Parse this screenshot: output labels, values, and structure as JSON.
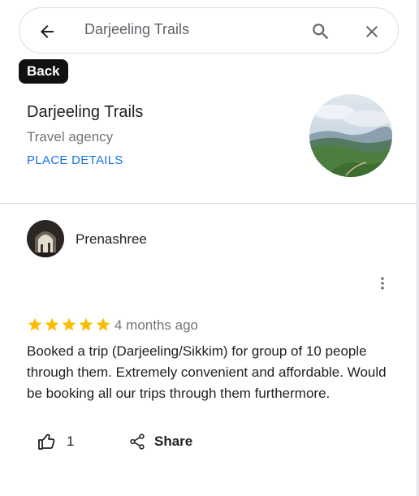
{
  "search": {
    "query": "Darjeeling Trails",
    "back_icon": "arrow-left-icon",
    "search_icon": "search-icon",
    "close_icon": "close-icon"
  },
  "tooltip": {
    "label": "Back"
  },
  "place": {
    "name": "Darjeeling Trails",
    "category": "Travel agency",
    "details_link": "PLACE DETAILS"
  },
  "review": {
    "reviewer_name": "Prenashree",
    "rating": 5,
    "rating_max": 5,
    "time_ago": "4 months ago",
    "text": "Booked a trip (Darjeeling/Sikkim) for group of 10 people through them. Extremely convenient and affordable. Would be booking all our trips through them furthermore.",
    "likes": "1",
    "share_label": "Share"
  },
  "colors": {
    "accent_blue": "#1a73e8",
    "star_yellow": "#fbbc04",
    "secondary_text": "#70757a"
  }
}
